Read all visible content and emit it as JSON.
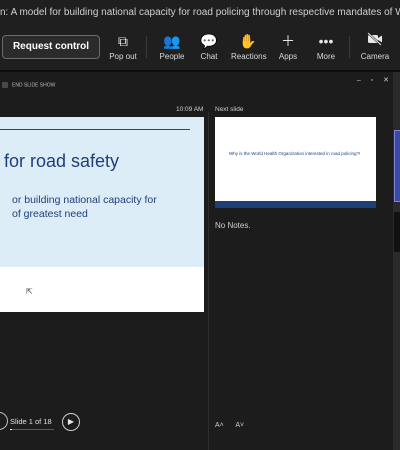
{
  "window": {
    "title": "n: A model for building national capacity for road policing through respective mandates of WHO"
  },
  "toolbar": {
    "request_control_label": "Request control",
    "items": [
      {
        "label": "Pop out",
        "icon": "pop-out-icon"
      },
      {
        "label": "People",
        "icon": "people-icon"
      },
      {
        "label": "Chat",
        "icon": "chat-icon"
      },
      {
        "label": "Reactions",
        "icon": "reactions-icon"
      },
      {
        "label": "Apps",
        "icon": "apps-icon"
      },
      {
        "label": "More",
        "icon": "more-icon"
      },
      {
        "label": "Camera",
        "icon": "camera-off-icon"
      }
    ]
  },
  "presenter": {
    "end_show_label": "END SLIDE SHOW",
    "clock": "10:09 AM",
    "next_slide_label": "Next slide",
    "current_slide": {
      "heading": "for road safety",
      "subtitle_line1": "or building national capacity for",
      "subtitle_line2": "of greatest need"
    },
    "next_slide_preview": {
      "question": "Why is the World Health Organization interested in road policing?!"
    },
    "notes_text": "No Notes.",
    "slide_counter": "Slide 1 of 18",
    "progress": 0.0556
  }
}
